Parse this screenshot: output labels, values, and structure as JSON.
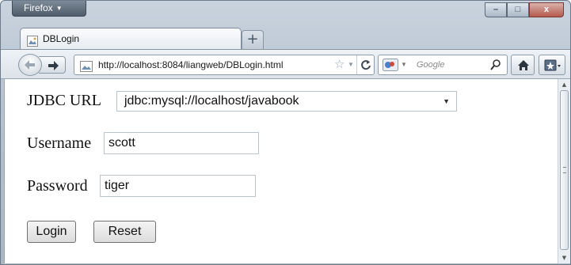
{
  "browser": {
    "menu_button": "Firefox",
    "window_controls": {
      "minimize": "–",
      "maximize": "□",
      "close": "x"
    }
  },
  "tab": {
    "title": "DBLogin",
    "new_tab": "+"
  },
  "navbar": {
    "url": "http://localhost:8084/liangweb/DBLogin.html",
    "search_placeholder": "Google",
    "icons": [
      "back-icon",
      "forward-icon",
      "site-icon",
      "star-icon",
      "reload-icon",
      "search-engine-icon",
      "search-icon",
      "home-icon",
      "bookmarks-icon"
    ]
  },
  "form": {
    "jdbc_label": "JDBC URL",
    "jdbc_value": "jdbc:mysql://localhost/javabook",
    "username_label": "Username",
    "username_value": "scott",
    "password_label": "Password",
    "password_value": "tiger",
    "login_label": "Login",
    "reset_label": "Reset"
  }
}
